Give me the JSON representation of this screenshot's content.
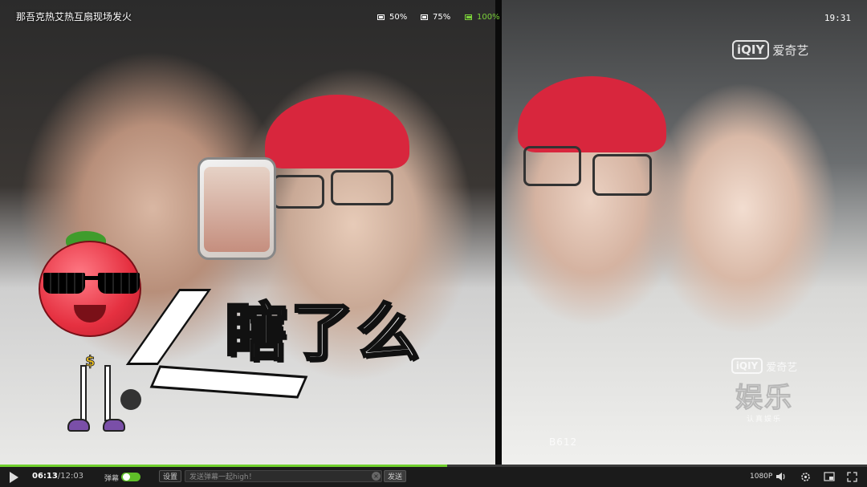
{
  "video": {
    "title": "那吾克热艾热互扇现场发火",
    "caption_big": "瞎了么",
    "quality_options": [
      "50%",
      "75%",
      "100%"
    ],
    "quality_selected": "100%",
    "clock": "19:31",
    "watermark_top": {
      "box": "iQIY",
      "text": "爱奇艺"
    },
    "watermark_ent": {
      "box": "iQIY",
      "text": "爱奇艺",
      "main": "娱乐",
      "sub": "认真娱乐"
    },
    "tag_b612": "B612"
  },
  "controls": {
    "time_current": "06:13",
    "time_separator": "/",
    "time_total": "12:03",
    "progress": 0.516,
    "danmu_label": "弹幕",
    "danmu_enabled": true,
    "settings_label": "设置",
    "input_placeholder": "发送弹幕一起high！",
    "send_label": "发送",
    "resolution": "1080P"
  },
  "colors": {
    "accent": "#6fcf2c",
    "bar_bg": "#1b1b1b"
  }
}
